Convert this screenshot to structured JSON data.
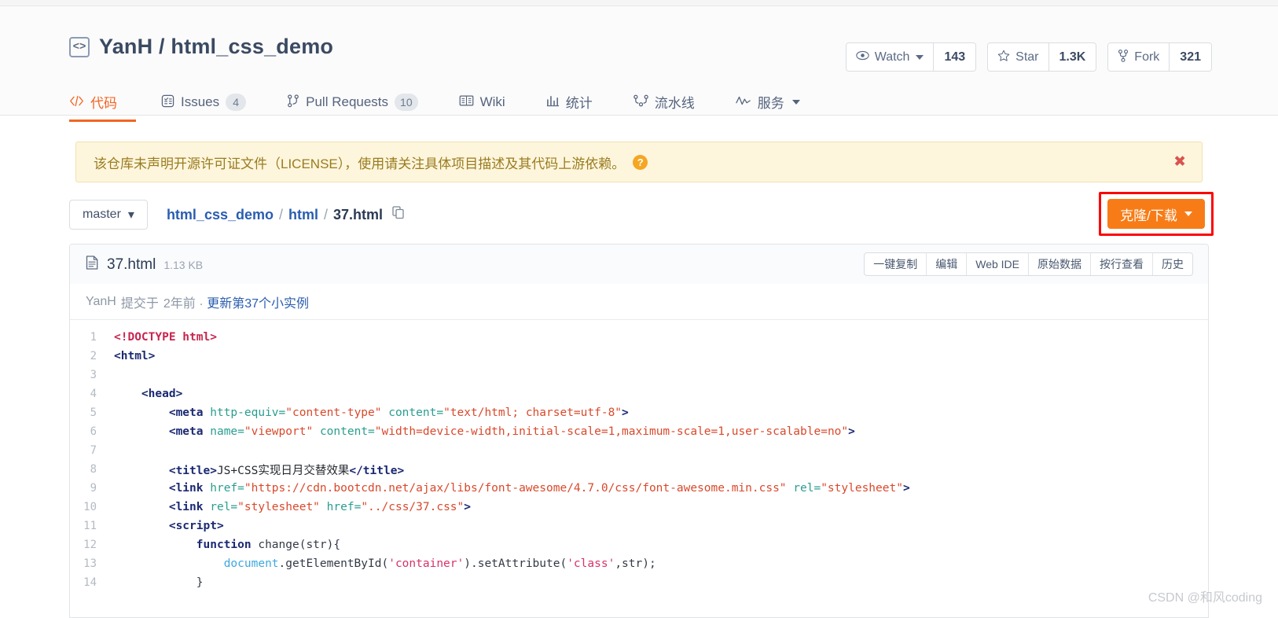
{
  "repo": {
    "icon": "code-brackets-icon",
    "owner": "YanH",
    "separator": "/",
    "name": "html_css_demo",
    "full_title": "YanH / html_css_demo"
  },
  "social": {
    "watch": {
      "icon": "eye-icon",
      "label": "Watch",
      "count": "143"
    },
    "star": {
      "icon": "star-icon",
      "label": "Star",
      "count": "1.3K"
    },
    "fork": {
      "icon": "fork-icon",
      "label": "Fork",
      "count": "321"
    }
  },
  "nav": {
    "tabs": [
      {
        "icon": "code-icon",
        "label": "代码",
        "badge": "",
        "active": true,
        "caret": false
      },
      {
        "icon": "issue-icon",
        "label": "Issues",
        "badge": "4",
        "active": false,
        "caret": false
      },
      {
        "icon": "pull-request-icon",
        "label": "Pull Requests",
        "badge": "10",
        "active": false,
        "caret": false
      },
      {
        "icon": "book-icon",
        "label": "Wiki",
        "badge": "",
        "active": false,
        "caret": false
      },
      {
        "icon": "chart-icon",
        "label": "统计",
        "badge": "",
        "active": false,
        "caret": false
      },
      {
        "icon": "pipeline-icon",
        "label": "流水线",
        "badge": "",
        "active": false,
        "caret": false
      },
      {
        "icon": "pulse-icon",
        "label": "服务",
        "badge": "",
        "active": false,
        "caret": true
      }
    ]
  },
  "banner": {
    "text": "该仓库未声明开源许可证文件（LICENSE），使用请关注具体项目描述及其代码上游依赖。",
    "help_icon": "?",
    "close_icon": "✖",
    "bg_color": "#fdf6dd",
    "text_color": "#9a7b1f"
  },
  "breadcrumb": {
    "branch": "master",
    "branch_caret": "▾",
    "parts": [
      {
        "text": "html_css_demo",
        "link": true
      },
      {
        "text": "/",
        "link": false
      },
      {
        "text": "html",
        "link": true
      },
      {
        "text": "/",
        "link": false
      },
      {
        "text": "37.html",
        "link": false
      }
    ],
    "copy_icon": "copy-icon"
  },
  "clone": {
    "label": "克隆/下载",
    "color": "#f77c17",
    "annotation_color": "#fb0606"
  },
  "file": {
    "icon": "file-text-icon",
    "name": "37.html",
    "size": "1.13 KB",
    "actions": [
      "一键复制",
      "编辑",
      "Web IDE",
      "原始数据",
      "按行查看",
      "历史"
    ]
  },
  "commit": {
    "author": "YanH",
    "verb": "提交于",
    "when": "2年前",
    "dot": ".",
    "message": "更新第37个小实例"
  },
  "code": {
    "lines": [
      {
        "n": "1",
        "tokens": [
          {
            "t": "doctype",
            "v": "<!DOCTYPE html>"
          }
        ]
      },
      {
        "n": "2",
        "tokens": [
          {
            "t": "tag",
            "v": "<html>"
          }
        ]
      },
      {
        "n": "3",
        "tokens": []
      },
      {
        "n": "4",
        "tokens": [
          {
            "t": "plain",
            "v": "    "
          },
          {
            "t": "tag",
            "v": "<head>"
          }
        ]
      },
      {
        "n": "5",
        "tokens": [
          {
            "t": "plain",
            "v": "        "
          },
          {
            "t": "tag",
            "v": "<meta "
          },
          {
            "t": "attr",
            "v": "http-equiv="
          },
          {
            "t": "val",
            "v": "\"content-type\""
          },
          {
            "t": "plain",
            "v": " "
          },
          {
            "t": "attr",
            "v": "content="
          },
          {
            "t": "val",
            "v": "\"text/html; charset=utf-8\""
          },
          {
            "t": "tag",
            "v": ">"
          }
        ]
      },
      {
        "n": "6",
        "tokens": [
          {
            "t": "plain",
            "v": "        "
          },
          {
            "t": "tag",
            "v": "<meta "
          },
          {
            "t": "attr",
            "v": "name="
          },
          {
            "t": "val",
            "v": "\"viewport\""
          },
          {
            "t": "plain",
            "v": " "
          },
          {
            "t": "attr",
            "v": "content="
          },
          {
            "t": "val",
            "v": "\"width=device-width,initial-scale=1,maximum-scale=1,user-scalable=no\""
          },
          {
            "t": "tag",
            "v": ">"
          }
        ]
      },
      {
        "n": "7",
        "tokens": []
      },
      {
        "n": "8",
        "tokens": [
          {
            "t": "plain",
            "v": "        "
          },
          {
            "t": "tag",
            "v": "<title>"
          },
          {
            "t": "text",
            "v": "JS+CSS实现日月交替效果"
          },
          {
            "t": "tag",
            "v": "</title>"
          }
        ]
      },
      {
        "n": "9",
        "tokens": [
          {
            "t": "plain",
            "v": "        "
          },
          {
            "t": "tag",
            "v": "<link "
          },
          {
            "t": "attr",
            "v": "href="
          },
          {
            "t": "val",
            "v": "\"https://cdn.bootcdn.net/ajax/libs/font-awesome/4.7.0/css/font-awesome.min.css\""
          },
          {
            "t": "plain",
            "v": " "
          },
          {
            "t": "attr",
            "v": "rel="
          },
          {
            "t": "val",
            "v": "\"stylesheet\""
          },
          {
            "t": "tag",
            "v": ">"
          }
        ]
      },
      {
        "n": "10",
        "tokens": [
          {
            "t": "plain",
            "v": "        "
          },
          {
            "t": "tag",
            "v": "<link "
          },
          {
            "t": "attr",
            "v": "rel="
          },
          {
            "t": "val",
            "v": "\"stylesheet\""
          },
          {
            "t": "plain",
            "v": " "
          },
          {
            "t": "attr",
            "v": "href="
          },
          {
            "t": "val",
            "v": "\"../css/37.css\""
          },
          {
            "t": "tag",
            "v": ">"
          }
        ]
      },
      {
        "n": "11",
        "tokens": [
          {
            "t": "plain",
            "v": "        "
          },
          {
            "t": "tag",
            "v": "<script>"
          }
        ]
      },
      {
        "n": "12",
        "tokens": [
          {
            "t": "plain",
            "v": "            "
          },
          {
            "t": "kw",
            "v": "function"
          },
          {
            "t": "plain",
            "v": " change(str){"
          }
        ]
      },
      {
        "n": "13",
        "tokens": [
          {
            "t": "plain",
            "v": "                "
          },
          {
            "t": "obj",
            "v": "document"
          },
          {
            "t": "plain",
            "v": ".getElementById("
          },
          {
            "t": "str",
            "v": "'container'"
          },
          {
            "t": "plain",
            "v": ").setAttribute("
          },
          {
            "t": "str",
            "v": "'class'"
          },
          {
            "t": "plain",
            "v": ",str);"
          }
        ]
      },
      {
        "n": "14",
        "tokens": [
          {
            "t": "plain",
            "v": "            }"
          }
        ]
      }
    ]
  },
  "watermark": "CSDN @和风coding"
}
